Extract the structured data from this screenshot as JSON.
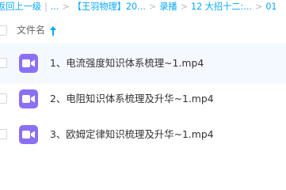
{
  "breadcrumb": {
    "items": [
      "返回上一级",
      "...",
      "【王羽物理】20...",
      "录播",
      "12 大招十二:...",
      "01"
    ],
    "separator": "|"
  },
  "list_header": {
    "column_label": "文件名",
    "sort_direction": "ascending",
    "sort_icon": "arrow-up-icon"
  },
  "files": [
    {
      "name": "1、电流强度知识体系梳理~1.mp4",
      "type": "video",
      "icon": "video-file-icon"
    },
    {
      "name": "2、电阻知识体系梳理及升华~1.mp4",
      "type": "video",
      "icon": "video-file-icon"
    },
    {
      "name": "3、欧姆定律知识梳理及升华~1.mp4",
      "type": "video",
      "icon": "video-file-icon"
    }
  ],
  "colors": {
    "accent": "#06a7ff",
    "video_icon": "#8a70f5",
    "row_highlight": "#f4f9ff"
  }
}
